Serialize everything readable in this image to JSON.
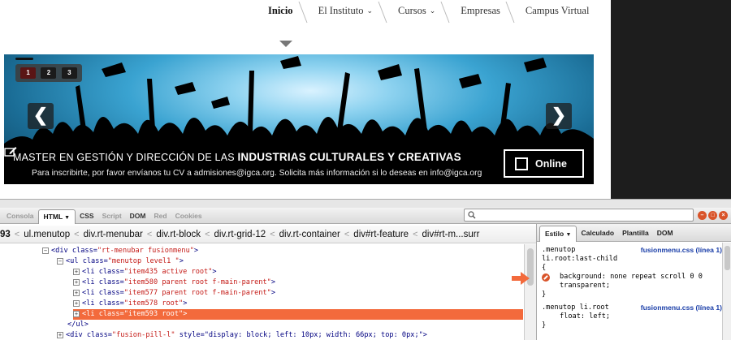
{
  "nav": {
    "items": [
      {
        "label": "Inicio",
        "has_dropdown": false,
        "active": true
      },
      {
        "label": "El Instituto",
        "has_dropdown": true,
        "active": false
      },
      {
        "label": "Cursos",
        "has_dropdown": true,
        "active": false
      },
      {
        "label": "Empresas",
        "has_dropdown": false,
        "active": false
      },
      {
        "label": "Campus Virtual",
        "has_dropdown": false,
        "active": false
      }
    ],
    "dropdown_glyph": "⌄"
  },
  "slider": {
    "pages": [
      "1",
      "2",
      "3"
    ],
    "active_page": "1",
    "prev_glyph": "❮",
    "next_glyph": "❯",
    "caption_prefix": "MASTER EN GESTIÓN Y DIRECCIÓN DE LAS ",
    "caption_bold": "INDUSTRIAS CULTURALES Y CREATIVAS",
    "subline": "Para inscribirte, por favor envíanos tu CV a admisiones@igca.org. Solicita más información si lo deseas en info@igca.org",
    "button_label": "Online"
  },
  "firebug": {
    "panel_tabs": [
      "Consola",
      "HTML",
      "CSS",
      "Script",
      "DOM",
      "Red",
      "Cookies"
    ],
    "selected_tab": "HTML",
    "search_icon": "search-icon",
    "window_buttons": [
      "minimize-icon",
      "restore-icon",
      "close-icon"
    ],
    "breadcrumbs": [
      "93",
      "ul.menutop",
      "div.rt-menubar",
      "div.rt-block",
      "div.rt-grid-12",
      "div.rt-container",
      "div#rt-feature",
      "div#rt-m...surr"
    ],
    "breadcrumb_sep": "<",
    "side_tabs": [
      "Estilo",
      "Calculado",
      "Plantilla",
      "DOM"
    ],
    "selected_side_tab": "Estilo",
    "accent": "#f36a3c"
  },
  "html_tree": [
    {
      "toggle": "−",
      "tag_open": "<div ",
      "attr": "class=",
      "value": "\"rt-menubar fusionmenu\"",
      "tag_close": ">"
    },
    {
      "toggle": "−",
      "tag_open": "<ul ",
      "attr": "class=",
      "value": "\"menutop level1 \"",
      "tag_close": ">"
    },
    {
      "toggle": "+",
      "tag_open": "<li ",
      "attr": "class=",
      "value": "\"item435 active root\"",
      "tag_close": ">"
    },
    {
      "toggle": "+",
      "tag_open": "<li ",
      "attr": "class=",
      "value": "\"item580 parent root f-main-parent\"",
      "tag_close": ">"
    },
    {
      "toggle": "+",
      "tag_open": "<li ",
      "attr": "class=",
      "value": "\"item577 parent root f-main-parent\"",
      "tag_close": ">"
    },
    {
      "toggle": "+",
      "tag_open": "<li ",
      "attr": "class=",
      "value": "\"item578 root\"",
      "tag_close": ">"
    },
    {
      "toggle": "+",
      "tag_open": "<li ",
      "attr": "class=",
      "value": "\"item593 root\"",
      "tag_close": ">",
      "selected": true
    },
    {
      "toggle": "",
      "tag_open": "</ul>",
      "attr": "",
      "value": "",
      "tag_close": ""
    },
    {
      "toggle": "+",
      "tag_open": "<div ",
      "attr": "class=",
      "value": "\"fusion-pill-l\"",
      "tag_close": " style=\"display: block; left: 10px; width: 66px; top: 0px;\">"
    }
  ],
  "css_rules": {
    "rule1_selector_a": ".menutop",
    "rule1_selector_b": "li.root:last-child",
    "rule1_source": "fusionmenu.css (línea 1)",
    "open_brace": "{",
    "rule1_prop": "background: none repeat scroll 0 0",
    "rule1_prop_cont": "transparent;",
    "close_brace": "}",
    "rule2_selector": ".menutop li.root",
    "rule2_source": "fusionmenu.css (línea 1)",
    "rule2_prop": "float: left;"
  }
}
